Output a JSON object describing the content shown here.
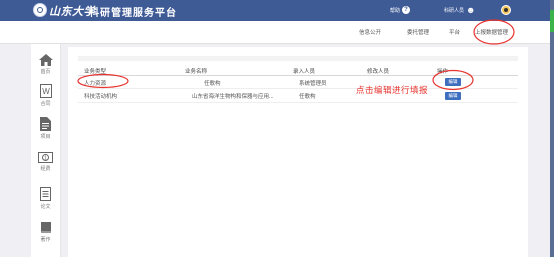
{
  "header": {
    "logo_text": "山东大学",
    "title": "科研管理服务平台",
    "help_label": "帮助",
    "user_label": "科研人员"
  },
  "nav": {
    "items": [
      "信息公开",
      "委托管理",
      "平台",
      "上报数据管理"
    ]
  },
  "sidebar": {
    "items": [
      {
        "label": "首页",
        "icon": "home-icon"
      },
      {
        "label": "合同",
        "icon": "word-doc-icon"
      },
      {
        "label": "项目",
        "icon": "document-icon"
      },
      {
        "label": "经费",
        "icon": "money-icon"
      },
      {
        "label": "论文",
        "icon": "paper-icon"
      },
      {
        "label": "著作",
        "icon": "book-icon"
      }
    ]
  },
  "table": {
    "headers": [
      "业务类型",
      "业务名称",
      "录入人员",
      "修改人员",
      "操作"
    ],
    "rows": [
      {
        "type": "人力资源",
        "name": "任歌构",
        "creator": "系统管理员",
        "modifier": "",
        "action": "编辑"
      },
      {
        "type": "科技活动机构",
        "name": "山东省海洋生物构和保器与应用...",
        "creator": "任歌构",
        "modifier": "",
        "action": "编辑"
      }
    ]
  },
  "annotation": {
    "note": "点击编辑进行填报",
    "color": "#e8332e"
  },
  "colors": {
    "topbar": "#3f5b96",
    "button": "#3e6fbf"
  }
}
